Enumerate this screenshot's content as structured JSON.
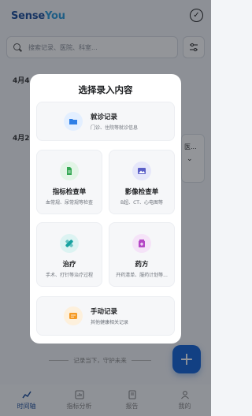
{
  "app": {
    "logo_part1": "Sense",
    "logo_part2": "You",
    "check_icon": "check-circle-icon"
  },
  "search": {
    "placeholder": "搜索记录、医院、科室..."
  },
  "timeline": {
    "dates": [
      "4月4",
      "4月2"
    ],
    "card_text": "医..."
  },
  "footer_hint": "记录当下，守护未来",
  "tabs": [
    {
      "label": "时间轴",
      "icon": "timeline-icon",
      "active": true
    },
    {
      "label": "指标分析",
      "icon": "chart-icon",
      "active": false
    },
    {
      "label": "报告",
      "icon": "report-icon",
      "active": false
    },
    {
      "label": "我的",
      "icon": "user-icon",
      "active": false
    }
  ],
  "modal": {
    "title": "选择录入内容",
    "options": [
      {
        "label": "就诊记录",
        "desc": "门诊、住院等就诊信息",
        "icon": "folder-icon",
        "color": "#2f7fe6",
        "bg": "#e3efff"
      },
      {
        "label": "指标检查单",
        "desc": "血常规、尿常规等检查",
        "icon": "document-icon",
        "color": "#34a853",
        "bg": "#e2f5e6"
      },
      {
        "label": "影像检查单",
        "desc": "B超、CT、心电图等",
        "icon": "image-icon",
        "color": "#5b5fc7",
        "bg": "#e6e7fa"
      },
      {
        "label": "治疗",
        "desc": "手术、打针等治疗过程",
        "icon": "bandage-icon",
        "color": "#17a2a0",
        "bg": "#dcf3f2"
      },
      {
        "label": "药方",
        "desc": "开药清单、服药计划等...",
        "icon": "medicine-icon",
        "color": "#b548c6",
        "bg": "#f5e3f8"
      },
      {
        "label": "手动记录",
        "desc": "其他健康相关记录",
        "icon": "note-icon",
        "color": "#f59a23",
        "bg": "#fdf0dc"
      }
    ]
  }
}
